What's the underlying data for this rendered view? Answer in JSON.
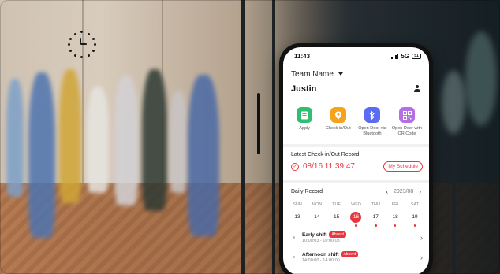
{
  "status_bar": {
    "time": "11:43",
    "network": "5G",
    "battery": "51"
  },
  "header": {
    "team_name": "Team Name",
    "user_name": "Justin"
  },
  "quick_actions": [
    {
      "label": "Apply",
      "icon": "document-icon",
      "color": "#2fbf71"
    },
    {
      "label": "Check in/Out",
      "icon": "location-pin-icon",
      "color": "#f7a21b"
    },
    {
      "label": "Open Door via Bluetooth",
      "icon": "bluetooth-icon",
      "color": "#5b6cf2"
    },
    {
      "label": "Open Door with QR Code",
      "icon": "qr-code-icon",
      "color": "#b46ee6"
    }
  ],
  "latest_record": {
    "title": "Latest Check-in/Out Record",
    "time": "08/16 11:39:47",
    "schedule_button": "My Schedule"
  },
  "daily_record": {
    "title": "Daily Record",
    "month": "2023/08",
    "weekdays": [
      "SUN",
      "MON",
      "TUE",
      "WED",
      "THU",
      "FRI",
      "SAT"
    ],
    "days": [
      {
        "num": "13",
        "dot": false,
        "selected": false
      },
      {
        "num": "14",
        "dot": false,
        "selected": false
      },
      {
        "num": "15",
        "dot": false,
        "selected": false
      },
      {
        "num": "16",
        "dot": true,
        "selected": true
      },
      {
        "num": "17",
        "dot": true,
        "selected": false
      },
      {
        "num": "18",
        "dot": true,
        "selected": false
      },
      {
        "num": "19",
        "dot": true,
        "selected": false
      }
    ],
    "shifts": [
      {
        "name": "Early shift",
        "badge": "Absent",
        "time": "10:00:03 - 10:00:03"
      },
      {
        "name": "Afternoon shift",
        "badge": "Absent",
        "time": "14:00:00 - 14:00:00"
      }
    ]
  },
  "colors": {
    "accent": "#e8363e"
  }
}
